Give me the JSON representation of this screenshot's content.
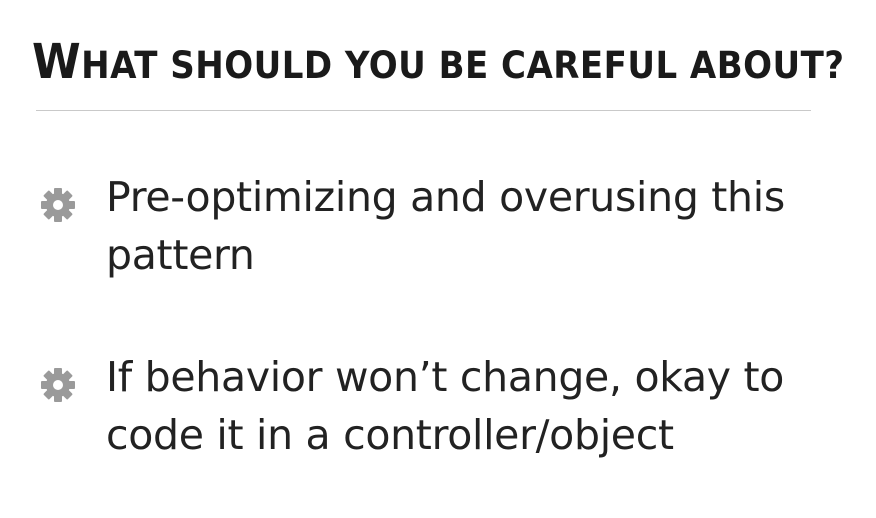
{
  "slide": {
    "title_first": "W",
    "title_rest": "HAT SHOULD YOU BE CAREFUL ABOUT?",
    "bullets": [
      {
        "icon": "gear-icon",
        "text": "Pre-optimizing and overusing this pattern"
      },
      {
        "icon": "gear-icon",
        "text": "If behavior won’t change, okay to code it in a controller/object"
      }
    ]
  },
  "colors": {
    "text": "#222222",
    "icon": "#9a9a9a",
    "rule": "#c9c9c9"
  }
}
